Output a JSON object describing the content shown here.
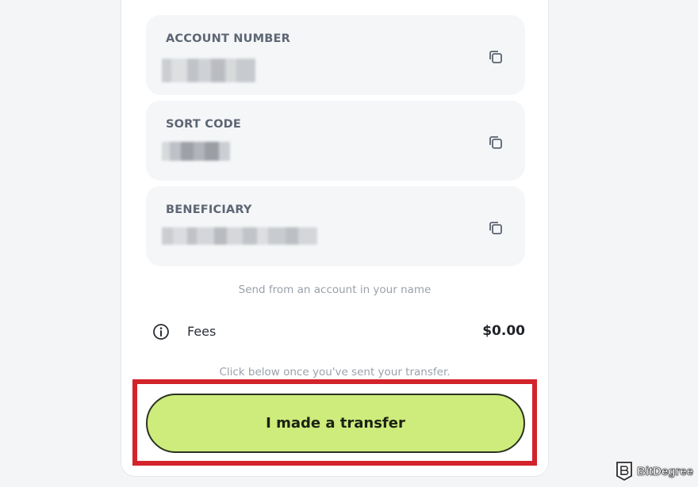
{
  "fields": [
    {
      "label": "ACCOUNT NUMBER",
      "value": "[redacted]",
      "copy_icon": "copy-icon"
    },
    {
      "label": "SORT CODE",
      "value": "[redacted]",
      "copy_icon": "copy-icon"
    },
    {
      "label": "BENEFICIARY",
      "value": "[redacted]",
      "copy_icon": "copy-icon"
    }
  ],
  "send_hint": "Send from an account in your name",
  "fees": {
    "icon": "info-icon",
    "label": "Fees",
    "amount": "$0.00"
  },
  "transfer_hint": "Click below once you've sent your transfer.",
  "transfer_button": {
    "label": "I made a transfer"
  },
  "highlight_color": "#d3232b",
  "button_color": "#cdec7c",
  "watermark": {
    "text": "BitDegree",
    "icon": "bitdegree-logo-icon"
  }
}
